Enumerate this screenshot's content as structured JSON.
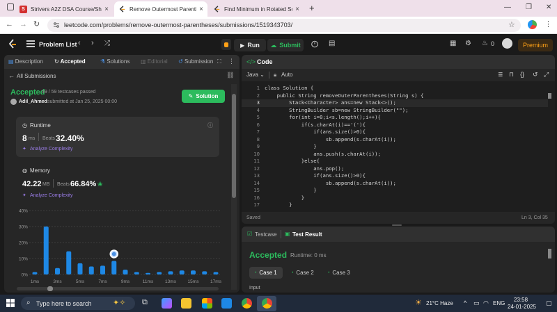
{
  "browser": {
    "tabs": [
      {
        "label": "Strivers A2Z DSA Course/Sheet",
        "fav": "S",
        "fav_color": "#d32f2f",
        "active": false
      },
      {
        "label": "Remove Outermost Parentheses",
        "fav": "",
        "fav_color": "#ffa116",
        "active": true
      },
      {
        "label": "Find Minimum in Rotated Sorte",
        "fav": "",
        "fav_color": "#ffa116",
        "active": false
      }
    ],
    "new_tab": "+",
    "url": "leetcode.com/problems/remove-outermost-parentheses/submissions/1519343703/"
  },
  "nav": {
    "problem_list": "Problem List",
    "run": "Run",
    "submit": "Submit",
    "streak": "0",
    "premium": "Premium"
  },
  "left": {
    "tabs": [
      {
        "label": "Description",
        "state": "normal"
      },
      {
        "label": "Accepted",
        "state": "active"
      },
      {
        "label": "Solutions",
        "state": "normal"
      },
      {
        "label": "Editorial",
        "state": "dim"
      },
      {
        "label": "Submission",
        "state": "normal"
      }
    ],
    "back": "All Submissions",
    "status": "Accepted",
    "passed": "59 / 59 testcases passed",
    "user": "Adil_Ahmed",
    "submitted": "submitted at Jan 25, 2025 00:00",
    "solution_btn": "Solution",
    "runtime": {
      "title": "Runtime",
      "value": "8",
      "unit": "ms",
      "beats_label": "Beats",
      "beats": "32.40%",
      "analyze": "Analyze Complexity"
    },
    "memory": {
      "title": "Memory",
      "value": "42.22",
      "unit": "MB",
      "beats_label": "Beats",
      "beats": "66.84%",
      "analyze": "Analyze Complexity"
    }
  },
  "chart_data": {
    "type": "bar",
    "categories": [
      "1ms",
      "2ms",
      "3ms",
      "4ms",
      "5ms",
      "6ms",
      "7ms",
      "8ms",
      "9ms",
      "10ms",
      "11ms",
      "12ms",
      "13ms",
      "14ms",
      "15ms",
      "16ms",
      "17ms"
    ],
    "values": [
      1.5,
      30,
      4,
      14.5,
      7,
      5,
      5.5,
      8.5,
      3,
      1.5,
      1,
      1.5,
      2,
      2.5,
      2.5,
      2,
      1.5
    ],
    "x_tick_labels": [
      "1ms",
      "3ms",
      "5ms",
      "7ms",
      "9ms",
      "11ms",
      "13ms",
      "15ms",
      "17ms"
    ],
    "y_tick_labels": [
      "0%",
      "10%",
      "20%",
      "30%",
      "40%"
    ],
    "ylim": [
      0,
      40
    ],
    "highlight_category": "8ms",
    "bar_color": "#1e88e5",
    "grid": true
  },
  "editor": {
    "title": "Code",
    "language": "Java",
    "mode": "Auto",
    "lines": [
      "class Solution {",
      "    public String removeOuterParentheses(String s) {",
      "        Stack<Character> ans=new Stack<>();",
      "        StringBuilder sb=new StringBuilder(\"\");",
      "        for(int i=0;i<s.length();i++){",
      "            if(s.charAt(i)=='('){",
      "                if(ans.size()>0){",
      "                    sb.append(s.charAt(i));",
      "                }",
      "                ans.push(s.charAt(i));",
      "            }else{",
      "                ans.pop();",
      "                if(ans.size()>0){",
      "                    sb.append(s.charAt(i));",
      "                }",
      "            }",
      "        }"
    ],
    "status": "Saved",
    "cursor": "Ln 3, Col 35"
  },
  "testresult": {
    "tab_testcase": "Testcase",
    "tab_result": "Test Result",
    "status": "Accepted",
    "runtime": "Runtime: 0 ms",
    "cases": [
      "Case 1",
      "Case 2",
      "Case 3"
    ],
    "input_label": "Input"
  },
  "taskbar": {
    "search": "Type here to search",
    "weather": "21°C  Haze",
    "lang": "ENG",
    "time": "23:58",
    "date": "24-01-2025"
  }
}
